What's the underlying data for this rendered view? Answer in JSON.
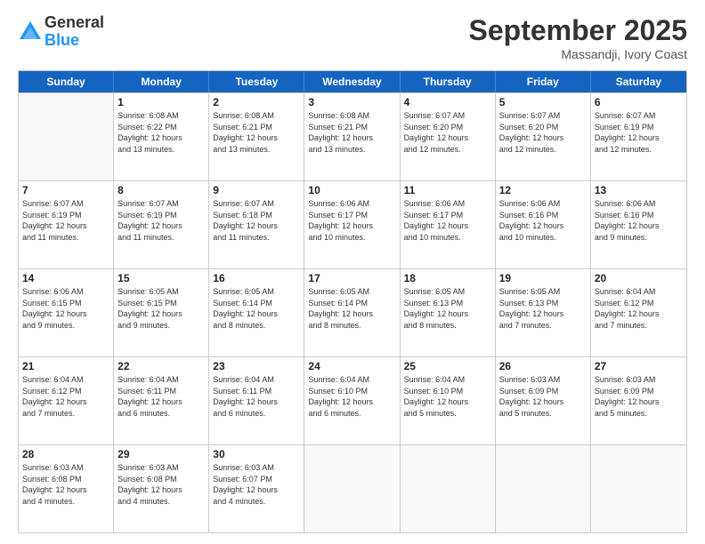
{
  "header": {
    "logo_general": "General",
    "logo_blue": "Blue",
    "month_title": "September 2025",
    "location": "Massandji, Ivory Coast"
  },
  "days_of_week": [
    "Sunday",
    "Monday",
    "Tuesday",
    "Wednesday",
    "Thursday",
    "Friday",
    "Saturday"
  ],
  "weeks": [
    [
      {
        "day": "",
        "info": ""
      },
      {
        "day": "1",
        "info": "Sunrise: 6:08 AM\nSunset: 6:22 PM\nDaylight: 12 hours\nand 13 minutes."
      },
      {
        "day": "2",
        "info": "Sunrise: 6:08 AM\nSunset: 6:21 PM\nDaylight: 12 hours\nand 13 minutes."
      },
      {
        "day": "3",
        "info": "Sunrise: 6:08 AM\nSunset: 6:21 PM\nDaylight: 12 hours\nand 13 minutes."
      },
      {
        "day": "4",
        "info": "Sunrise: 6:07 AM\nSunset: 6:20 PM\nDaylight: 12 hours\nand 12 minutes."
      },
      {
        "day": "5",
        "info": "Sunrise: 6:07 AM\nSunset: 6:20 PM\nDaylight: 12 hours\nand 12 minutes."
      },
      {
        "day": "6",
        "info": "Sunrise: 6:07 AM\nSunset: 6:19 PM\nDaylight: 12 hours\nand 12 minutes."
      }
    ],
    [
      {
        "day": "7",
        "info": "Sunrise: 6:07 AM\nSunset: 6:19 PM\nDaylight: 12 hours\nand 11 minutes."
      },
      {
        "day": "8",
        "info": "Sunrise: 6:07 AM\nSunset: 6:19 PM\nDaylight: 12 hours\nand 11 minutes."
      },
      {
        "day": "9",
        "info": "Sunrise: 6:07 AM\nSunset: 6:18 PM\nDaylight: 12 hours\nand 11 minutes."
      },
      {
        "day": "10",
        "info": "Sunrise: 6:06 AM\nSunset: 6:17 PM\nDaylight: 12 hours\nand 10 minutes."
      },
      {
        "day": "11",
        "info": "Sunrise: 6:06 AM\nSunset: 6:17 PM\nDaylight: 12 hours\nand 10 minutes."
      },
      {
        "day": "12",
        "info": "Sunrise: 6:06 AM\nSunset: 6:16 PM\nDaylight: 12 hours\nand 10 minutes."
      },
      {
        "day": "13",
        "info": "Sunrise: 6:06 AM\nSunset: 6:16 PM\nDaylight: 12 hours\nand 9 minutes."
      }
    ],
    [
      {
        "day": "14",
        "info": "Sunrise: 6:06 AM\nSunset: 6:15 PM\nDaylight: 12 hours\nand 9 minutes."
      },
      {
        "day": "15",
        "info": "Sunrise: 6:05 AM\nSunset: 6:15 PM\nDaylight: 12 hours\nand 9 minutes."
      },
      {
        "day": "16",
        "info": "Sunrise: 6:05 AM\nSunset: 6:14 PM\nDaylight: 12 hours\nand 8 minutes."
      },
      {
        "day": "17",
        "info": "Sunrise: 6:05 AM\nSunset: 6:14 PM\nDaylight: 12 hours\nand 8 minutes."
      },
      {
        "day": "18",
        "info": "Sunrise: 6:05 AM\nSunset: 6:13 PM\nDaylight: 12 hours\nand 8 minutes."
      },
      {
        "day": "19",
        "info": "Sunrise: 6:05 AM\nSunset: 6:13 PM\nDaylight: 12 hours\nand 7 minutes."
      },
      {
        "day": "20",
        "info": "Sunrise: 6:04 AM\nSunset: 6:12 PM\nDaylight: 12 hours\nand 7 minutes."
      }
    ],
    [
      {
        "day": "21",
        "info": "Sunrise: 6:04 AM\nSunset: 6:12 PM\nDaylight: 12 hours\nand 7 minutes."
      },
      {
        "day": "22",
        "info": "Sunrise: 6:04 AM\nSunset: 6:11 PM\nDaylight: 12 hours\nand 6 minutes."
      },
      {
        "day": "23",
        "info": "Sunrise: 6:04 AM\nSunset: 6:11 PM\nDaylight: 12 hours\nand 6 minutes."
      },
      {
        "day": "24",
        "info": "Sunrise: 6:04 AM\nSunset: 6:10 PM\nDaylight: 12 hours\nand 6 minutes."
      },
      {
        "day": "25",
        "info": "Sunrise: 6:04 AM\nSunset: 6:10 PM\nDaylight: 12 hours\nand 5 minutes."
      },
      {
        "day": "26",
        "info": "Sunrise: 6:03 AM\nSunset: 6:09 PM\nDaylight: 12 hours\nand 5 minutes."
      },
      {
        "day": "27",
        "info": "Sunrise: 6:03 AM\nSunset: 6:09 PM\nDaylight: 12 hours\nand 5 minutes."
      }
    ],
    [
      {
        "day": "28",
        "info": "Sunrise: 6:03 AM\nSunset: 6:08 PM\nDaylight: 12 hours\nand 4 minutes."
      },
      {
        "day": "29",
        "info": "Sunrise: 6:03 AM\nSunset: 6:08 PM\nDaylight: 12 hours\nand 4 minutes."
      },
      {
        "day": "30",
        "info": "Sunrise: 6:03 AM\nSunset: 6:07 PM\nDaylight: 12 hours\nand 4 minutes."
      },
      {
        "day": "",
        "info": ""
      },
      {
        "day": "",
        "info": ""
      },
      {
        "day": "",
        "info": ""
      },
      {
        "day": "",
        "info": ""
      }
    ]
  ]
}
